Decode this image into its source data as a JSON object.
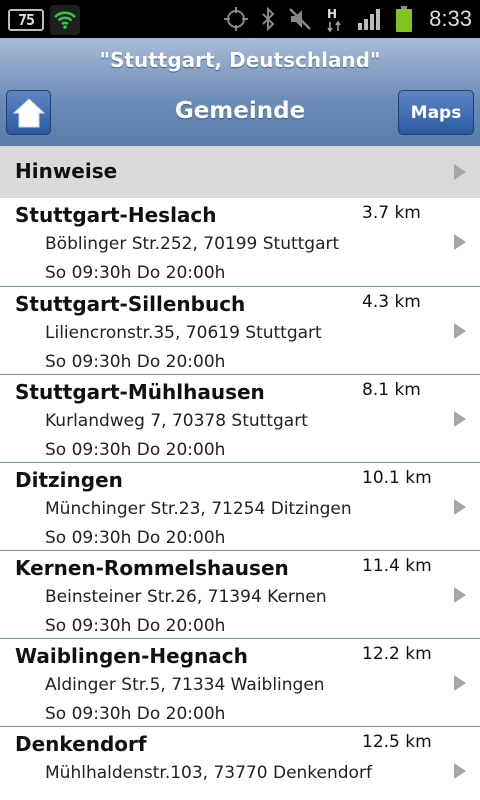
{
  "status_bar": {
    "notification_badge": "75",
    "time": "8:33",
    "icons": [
      "notification-75-icon",
      "wifi-shield-icon",
      "gps-icon",
      "bluetooth-icon",
      "mute-icon",
      "hspa-data-icon",
      "signal-icon",
      "battery-icon"
    ],
    "colors": {
      "wifi_green": "#2ecc40",
      "battery_green": "#7fc31c"
    }
  },
  "header": {
    "location": "\"Stuttgart, Deutschland\"",
    "title": "Gemeinde",
    "home_icon": "home-icon",
    "maps_label": "Maps",
    "colors": {
      "bar_top": "#a9bcd6",
      "bar_bottom": "#5a7daa",
      "button": "#2a5aa3"
    }
  },
  "list": {
    "hinweise_label": "Hinweise",
    "items": [
      {
        "name": "Stuttgart-Heslach",
        "distance": "3.7 km",
        "address": "Böblinger Str.252, 70199 Stuttgart",
        "hours": "So 09:30h Do 20:00h"
      },
      {
        "name": "Stuttgart-Sillenbuch",
        "distance": "4.3 km",
        "address": "Liliencronstr.35, 70619 Stuttgart",
        "hours": "So 09:30h Do 20:00h"
      },
      {
        "name": "Stuttgart-Mühlhausen",
        "distance": "8.1 km",
        "address": "Kurlandweg 7, 70378 Stuttgart",
        "hours": "So 09:30h Do 20:00h"
      },
      {
        "name": "Ditzingen",
        "distance": "10.1 km",
        "address": "Münchinger Str.23, 71254 Ditzingen",
        "hours": "So 09:30h Do 20:00h"
      },
      {
        "name": "Kernen-Rommelshausen",
        "distance": "11.4 km",
        "address": "Beinsteiner Str.26, 71394 Kernen",
        "hours": "So 09:30h Do 20:00h"
      },
      {
        "name": "Waiblingen-Hegnach",
        "distance": "12.2 km",
        "address": "Aldinger Str.5, 71334 Waiblingen",
        "hours": "So 09:30h Do 20:00h"
      },
      {
        "name": "Denkendorf",
        "distance": "12.5 km",
        "address": "Mühlhaldenstr.103, 73770 Denkendorf",
        "hours": ""
      }
    ]
  }
}
